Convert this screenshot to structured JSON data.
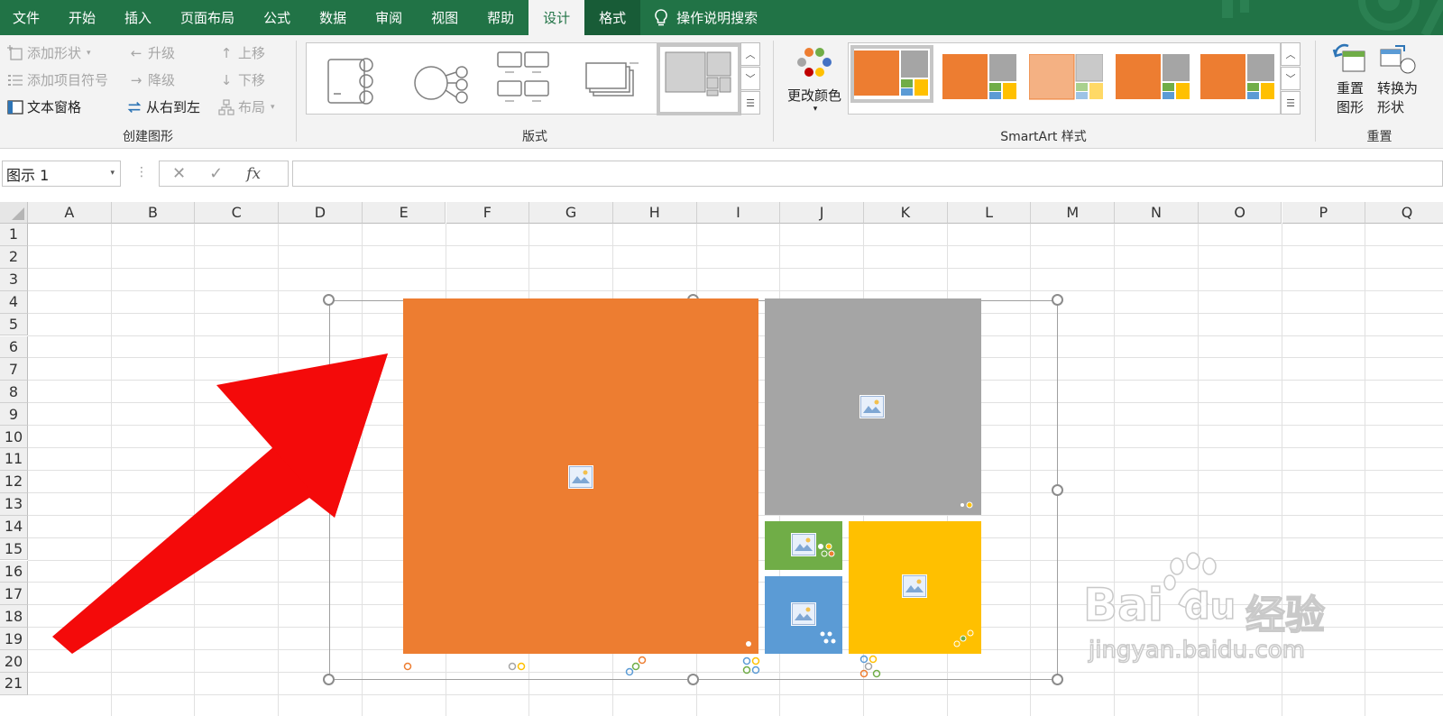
{
  "tabs": [
    "文件",
    "开始",
    "插入",
    "页面布局",
    "公式",
    "数据",
    "审阅",
    "视图",
    "帮助",
    "设计",
    "格式"
  ],
  "active_tab": "设计",
  "tell_me": "操作说明搜索",
  "create_graphic": {
    "add_shape": "添加形状",
    "add_bullet": "添加项目符号",
    "text_pane": "文本窗格",
    "promote": "升级",
    "demote": "降级",
    "right_to_left": "从右到左",
    "move_up": "上移",
    "move_down": "下移",
    "layout": "布局",
    "group_label": "创建图形"
  },
  "layouts": {
    "group_label": "版式"
  },
  "smartart_styles": {
    "change_colors": "更改颜色",
    "group_label": "SmartArt 样式"
  },
  "reset": {
    "reset_graphic_1": "重置",
    "reset_graphic_2": "图形",
    "convert_1": "转换为",
    "convert_2": "形状",
    "group_label": "重置"
  },
  "formula_bar": {
    "name_box": "图示 1",
    "fx": "fx"
  },
  "sheet": {
    "columns": [
      "A",
      "B",
      "C",
      "D",
      "E",
      "F",
      "G",
      "H",
      "I",
      "J",
      "K",
      "L",
      "M",
      "N",
      "O",
      "P",
      "Q"
    ],
    "rows": [
      "1",
      "2",
      "3",
      "4",
      "5",
      "6",
      "7",
      "8",
      "9",
      "10",
      "11",
      "12",
      "13",
      "14",
      "15",
      "16",
      "17",
      "18",
      "19",
      "20",
      "21"
    ]
  },
  "smartart": {
    "shapes": [
      {
        "name": "orange",
        "color": "#ED7D31"
      },
      {
        "name": "gray",
        "color": "#A5A5A5"
      },
      {
        "name": "green",
        "color": "#70AD47"
      },
      {
        "name": "blue",
        "color": "#5B9BD5"
      },
      {
        "name": "gold",
        "color": "#FFC000"
      }
    ]
  },
  "annotation_arrow_color": "#F40A0A",
  "watermark": {
    "brand": "Bai",
    "brand2": "du",
    "suffix": "经验",
    "url": "jingyan.baidu.com"
  },
  "colors": {
    "excel_green": "#217346",
    "format_tab": "#185C37"
  }
}
